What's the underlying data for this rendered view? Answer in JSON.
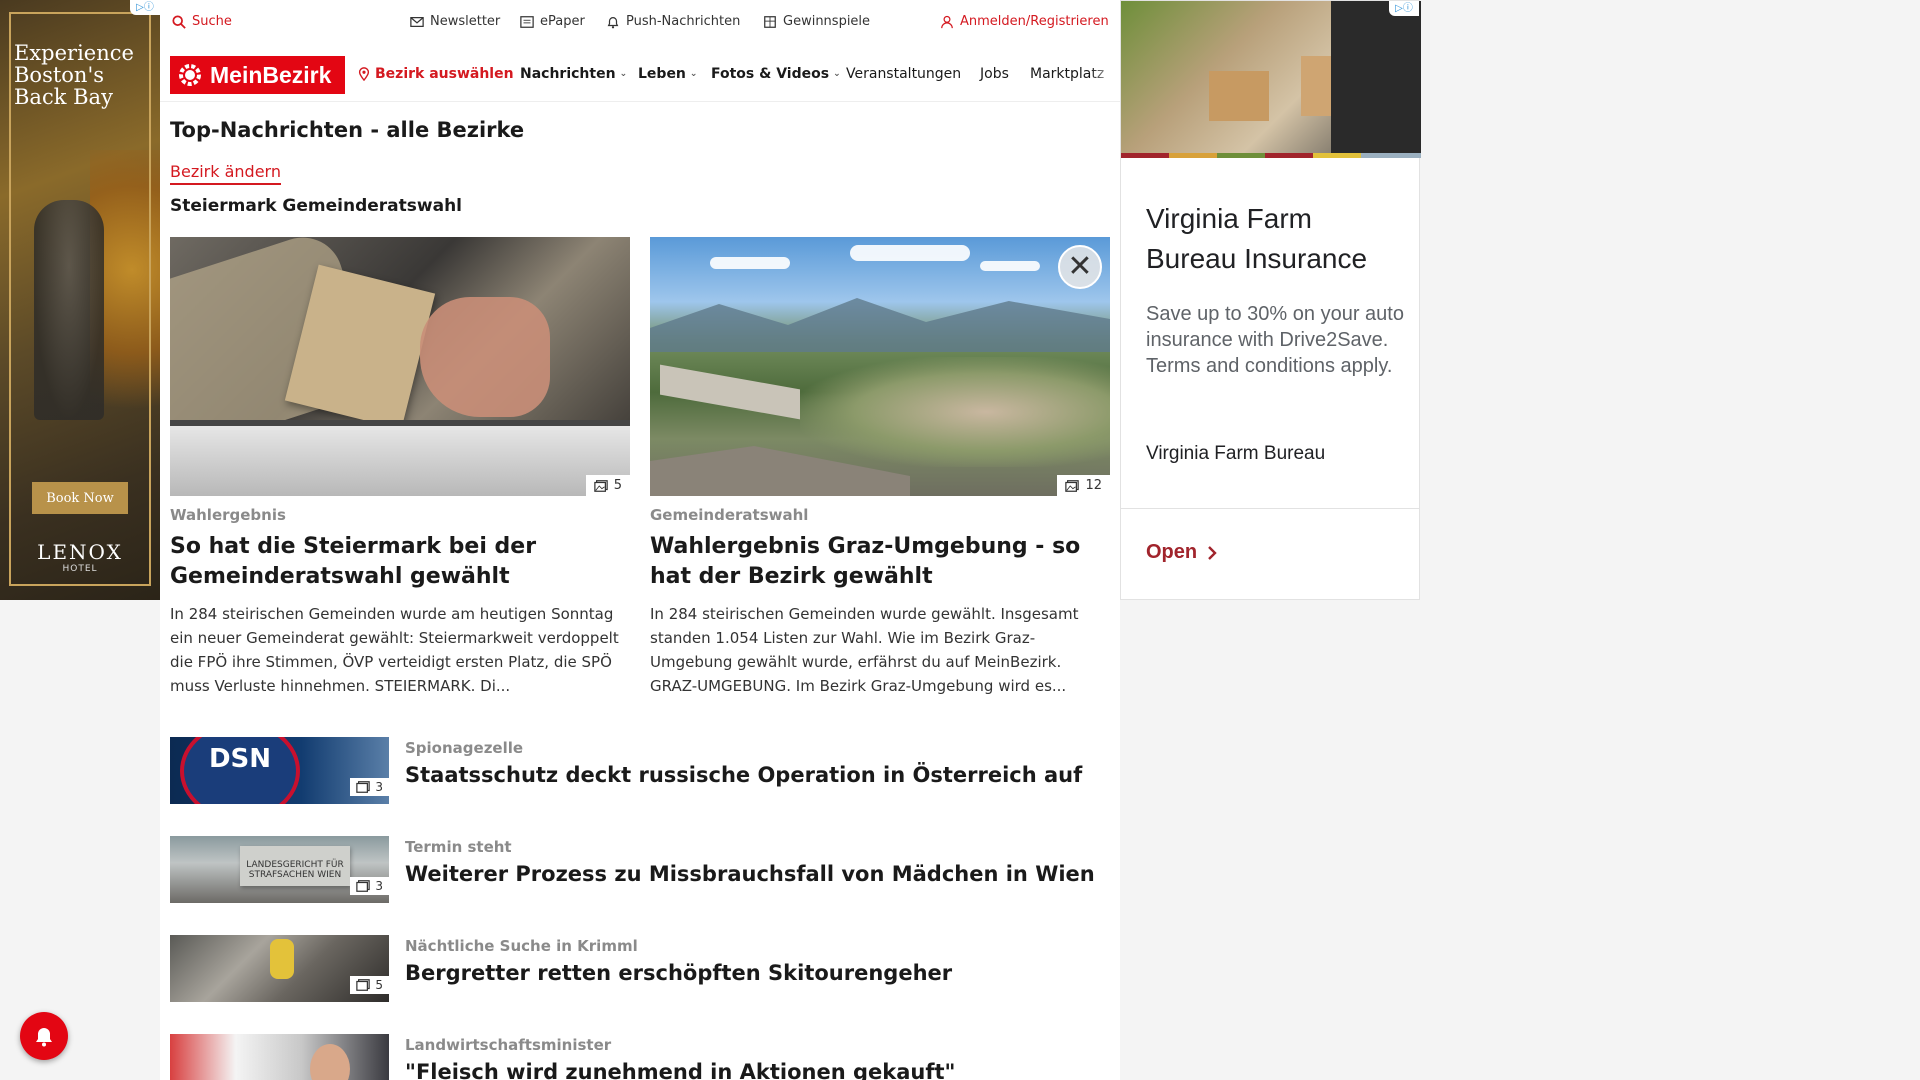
{
  "ads": {
    "left": {
      "headline": "Experience Boston's Back Bay",
      "cta": "Book Now",
      "brand": "LENOX",
      "brand_sub": "HOTEL"
    },
    "right": {
      "title": "Virginia Farm Bureau Insurance",
      "body": "Save up to 30% on your auto insurance with Drive2Save. Terms and conditions apply.",
      "advertiser": "Virginia Farm Bureau",
      "cta": "Open"
    }
  },
  "topbar": {
    "search": "Suche",
    "newsletter": "Newsletter",
    "epaper": "ePaper",
    "push": "Push-Nachrichten",
    "contests": "Gewinnspiele",
    "login": "Anmelden/Registrieren"
  },
  "nav": {
    "logo": "MeinBezirk",
    "select_district": "Bezirk auswählen",
    "items": [
      "Nachrichten",
      "Leben",
      "Fotos & Videos",
      "Veranstaltungen",
      "Jobs",
      "Marktplatz"
    ]
  },
  "page": {
    "title": "Top-Nachrichten - alle Bezirke",
    "change_district": "Bezirk ändern",
    "section": "Steiermark Gemeinderatswahl"
  },
  "featured": [
    {
      "kicker": "Wahlergebnis",
      "headline": "So hat die Steiermark bei der Gemeinderatswahl gewählt",
      "teaser": "In 284 steirischen Gemeinden wurde am heutigen Sonntag ein neuer Gemeinderat gewählt: Steiermarkweit verdoppelt die FPÖ ihre Stimmen, ÖVP verteidigt ersten Platz, die SPÖ muss Verluste hinnehmen.  STEIERMARK. Di...",
      "photo_count": "5"
    },
    {
      "kicker": "Gemeinderatswahl",
      "headline": "Wahlergebnis Graz-Umgebung - so hat der Bezirk gewählt",
      "teaser": "In 284 steirischen Gemeinden wurde gewählt. Insgesamt standen 1.054 Listen zur Wahl. Wie im Bezirk Graz-Umgebung gewählt wurde, erfährst du auf MeinBezirk. GRAZ-UMGEBUNG. Im Bezirk Graz-Umgebung wird es...",
      "photo_count": "12"
    }
  ],
  "list": [
    {
      "kicker": "Spionagezelle",
      "headline": "Staatsschutz deckt russische Operation in Österreich auf",
      "photo_count": "3",
      "thumb_text": "DSN"
    },
    {
      "kicker": "Termin steht",
      "headline": "Weiterer Prozess zu Missbrauchsfall von Mädchen in Wien",
      "photo_count": "3",
      "thumb_text": "LANDESGERICHT FÜR STRAFSACHEN WIEN"
    },
    {
      "kicker": "Nächtliche Suche in Krimml",
      "headline": "Bergretter retten erschöpften Skitourengeher",
      "photo_count": "5"
    },
    {
      "kicker": "Landwirtschaftsminister",
      "headline": "\"Fleisch wird zunehmend in Aktionen gekauft\""
    }
  ],
  "colors": {
    "brand_red": "#e30613",
    "ad_red": "#a1242c"
  }
}
